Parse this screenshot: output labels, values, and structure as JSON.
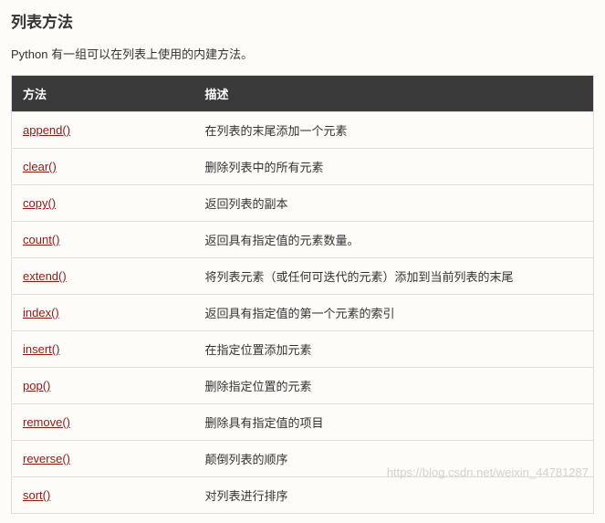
{
  "title": "列表方法",
  "intro": "Python 有一组可以在列表上使用的内建方法。",
  "table": {
    "headers": {
      "method": "方法",
      "description": "描述"
    },
    "rows": [
      {
        "method": "append()",
        "description": "在列表的末尾添加一个元素"
      },
      {
        "method": "clear()",
        "description": "删除列表中的所有元素"
      },
      {
        "method": "copy()",
        "description": "返回列表的副本"
      },
      {
        "method": "count()",
        "description": "返回具有指定值的元素数量。"
      },
      {
        "method": "extend()",
        "description": "将列表元素（或任何可迭代的元素）添加到当前列表的末尾"
      },
      {
        "method": "index()",
        "description": "返回具有指定值的第一个元素的索引"
      },
      {
        "method": "insert()",
        "description": "在指定位置添加元素"
      },
      {
        "method": "pop()",
        "description": "删除指定位置的元素"
      },
      {
        "method": "remove()",
        "description": "删除具有指定值的项目"
      },
      {
        "method": "reverse()",
        "description": "颠倒列表的顺序"
      },
      {
        "method": "sort()",
        "description": "对列表进行排序"
      }
    ]
  },
  "watermark": "https://blog.csdn.net/weixin_44781287"
}
